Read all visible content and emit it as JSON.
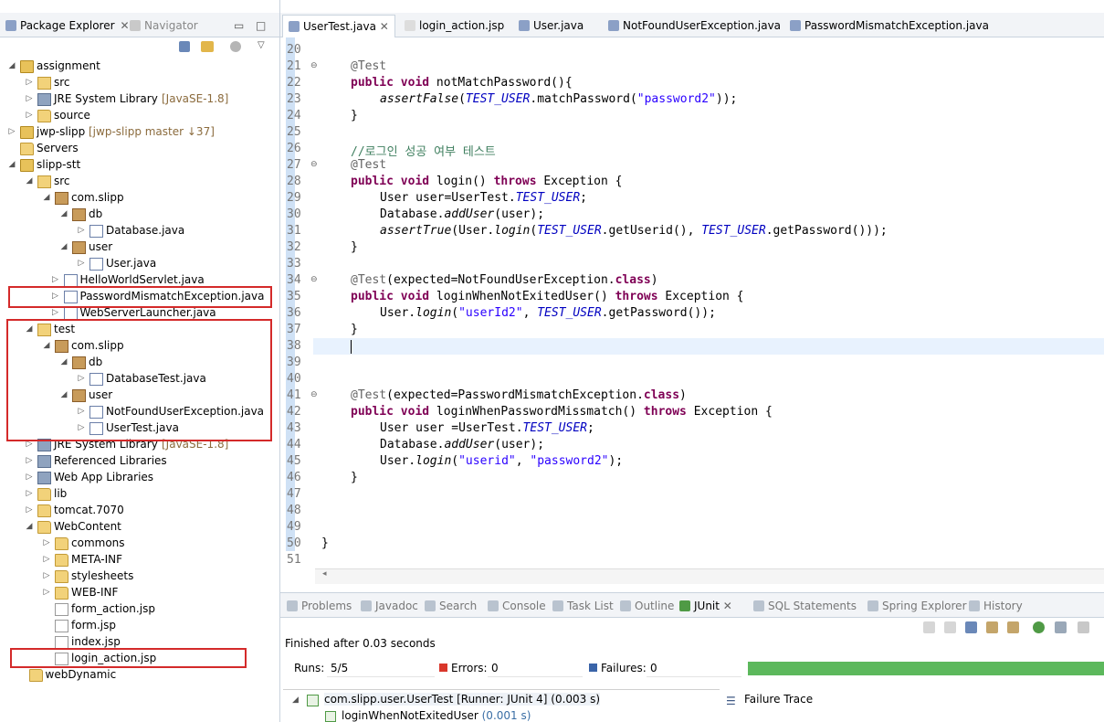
{
  "explorer": {
    "tab_active": "Package Explorer",
    "tab_inactive": "Navigator",
    "tree": [
      {
        "label": "assignment",
        "deco": "",
        "indent": 0,
        "twisty": "open",
        "icon": "proj"
      },
      {
        "label": "src",
        "deco": "",
        "indent": 1,
        "twisty": "closed",
        "icon": "srcfolder"
      },
      {
        "label": "JRE System Library",
        "deco": "[JavaSE-1.8]",
        "indent": 1,
        "twisty": "closed",
        "icon": "lib"
      },
      {
        "label": "source",
        "deco": "",
        "indent": 1,
        "twisty": "closed",
        "icon": "folder"
      },
      {
        "label": "jwp-slipp",
        "deco": "[jwp-slipp master ↓37]",
        "indent": 0,
        "twisty": "closed",
        "icon": "proj"
      },
      {
        "label": "Servers",
        "deco": "",
        "indent": 0,
        "twisty": "none",
        "icon": "folder"
      },
      {
        "label": "slipp-stt",
        "deco": "",
        "indent": 0,
        "twisty": "open",
        "icon": "proj"
      },
      {
        "label": "src",
        "deco": "",
        "indent": 1,
        "twisty": "open",
        "icon": "srcfolder"
      },
      {
        "label": "com.slipp",
        "deco": "",
        "indent": 2,
        "twisty": "open",
        "icon": "pkg"
      },
      {
        "label": "db",
        "deco": "",
        "indent": 3,
        "twisty": "open",
        "icon": "pkg"
      },
      {
        "label": "Database.java",
        "deco": "",
        "indent": 4,
        "twisty": "closed",
        "icon": "java"
      },
      {
        "label": "user",
        "deco": "",
        "indent": 3,
        "twisty": "open",
        "icon": "pkg"
      },
      {
        "label": "User.java",
        "deco": "",
        "indent": 4,
        "twisty": "closed",
        "icon": "java"
      },
      {
        "label": "HelloWorldServlet.java",
        "deco": "",
        "indent": 2.5,
        "twisty": "closed",
        "icon": "java"
      },
      {
        "label": "PasswordMismatchException.java",
        "deco": "",
        "indent": 2.5,
        "twisty": "closed",
        "icon": "java"
      },
      {
        "label": "WebServerLauncher.java",
        "deco": "",
        "indent": 2.5,
        "twisty": "closed",
        "icon": "java"
      },
      {
        "label": "test",
        "deco": "",
        "indent": 1,
        "twisty": "open",
        "icon": "srcfolder"
      },
      {
        "label": "com.slipp",
        "deco": "",
        "indent": 2,
        "twisty": "open",
        "icon": "pkg"
      },
      {
        "label": "db",
        "deco": "",
        "indent": 3,
        "twisty": "open",
        "icon": "pkg"
      },
      {
        "label": "DatabaseTest.java",
        "deco": "",
        "indent": 4,
        "twisty": "closed",
        "icon": "java"
      },
      {
        "label": "user",
        "deco": "",
        "indent": 3,
        "twisty": "open",
        "icon": "pkg"
      },
      {
        "label": "NotFoundUserException.java",
        "deco": "",
        "indent": 4,
        "twisty": "closed",
        "icon": "java"
      },
      {
        "label": "UserTest.java",
        "deco": "",
        "indent": 4,
        "twisty": "closed",
        "icon": "java"
      },
      {
        "label": "JRE System Library",
        "deco": "[JavaSE-1.8]",
        "indent": 1,
        "twisty": "closed",
        "icon": "lib"
      },
      {
        "label": "Referenced Libraries",
        "deco": "",
        "indent": 1,
        "twisty": "closed",
        "icon": "lib"
      },
      {
        "label": "Web App Libraries",
        "deco": "",
        "indent": 1,
        "twisty": "closed",
        "icon": "lib"
      },
      {
        "label": "lib",
        "deco": "",
        "indent": 1,
        "twisty": "closed",
        "icon": "folder"
      },
      {
        "label": "tomcat.7070",
        "deco": "",
        "indent": 1,
        "twisty": "closed",
        "icon": "folder"
      },
      {
        "label": "WebContent",
        "deco": "",
        "indent": 1,
        "twisty": "open",
        "icon": "folder"
      },
      {
        "label": "commons",
        "deco": "",
        "indent": 2,
        "twisty": "closed",
        "icon": "folder"
      },
      {
        "label": "META-INF",
        "deco": "",
        "indent": 2,
        "twisty": "closed",
        "icon": "folder"
      },
      {
        "label": "stylesheets",
        "deco": "",
        "indent": 2,
        "twisty": "closed",
        "icon": "folder"
      },
      {
        "label": "WEB-INF",
        "deco": "",
        "indent": 2,
        "twisty": "closed",
        "icon": "folder"
      },
      {
        "label": "form_action.jsp",
        "deco": "",
        "indent": 2,
        "twisty": "none",
        "icon": "jsp"
      },
      {
        "label": "form.jsp",
        "deco": "",
        "indent": 2,
        "twisty": "none",
        "icon": "jsp"
      },
      {
        "label": "index.jsp",
        "deco": "",
        "indent": 2,
        "twisty": "none",
        "icon": "jsp"
      },
      {
        "label": "login_action.jsp",
        "deco": "",
        "indent": 2,
        "twisty": "none",
        "icon": "jsp"
      },
      {
        "label": "webDynamic",
        "deco": "",
        "indent": 0.5,
        "twisty": "none",
        "icon": "folder"
      }
    ]
  },
  "editor": {
    "tabs": [
      "UserTest.java",
      "login_action.jsp",
      "User.java",
      "NotFoundUserException.java",
      "PasswordMismatchException.java"
    ],
    "active_tab": "UserTest.java"
  },
  "code": {
    "line_numbers": [
      "20",
      "21",
      "22",
      "23",
      "24",
      "25",
      "26",
      "27",
      "28",
      "29",
      "30",
      "31",
      "32",
      "33",
      "34",
      "35",
      "36",
      "37",
      "38",
      "39",
      "40",
      "41",
      "42",
      "43",
      "44",
      "45",
      "46",
      "47",
      "48",
      "49",
      "50",
      "51"
    ],
    "l21_a": "@Test",
    "l22_kw1": "public",
    "l22_kw2": "void",
    "l22_rest": " notMatchPassword(){",
    "l23_call": "assertFalse",
    "l23_const": "TEST_USER",
    "l23_mid": ".matchPassword(",
    "l23_str": "\"password2\"",
    "l23_end": "));",
    "brace_close": "}",
    "l26_comment": "//로그인 성공 여부 테스트",
    "l27_a": "@Test",
    "l28_kw1": "public",
    "l28_kw2": "void",
    "l28_mid": " login() ",
    "l28_kw3": "throws",
    "l28_end": " Exception {",
    "l29_a": "User user=UserTest.",
    "l29_const": "TEST_USER",
    "l29_end": ";",
    "l30_a": "Database.",
    "l30_call": "addUser",
    "l30_end": "(user);",
    "l31_call": "assertTrue",
    "l31_a": "(User.",
    "l31_call2": "login",
    "l31_b": "(",
    "l31_const": "TEST_USER",
    "l31_c": ".getUserid(), ",
    "l31_const2": "TEST_USER",
    "l31_end": ".getPassword()));",
    "l34_a": "@Test",
    "l34_b": "(expected=NotFoundUserException.",
    "l34_kw": "class",
    "l34_end": ")",
    "l35_kw1": "public",
    "l35_kw2": "void",
    "l35_mid": " loginWhenNotExitedUser() ",
    "l35_kw3": "throws",
    "l35_end": " Exception {",
    "l36_a": "User.",
    "l36_call": "login",
    "l36_b": "(",
    "l36_str": "\"userId2\"",
    "l36_c": ", ",
    "l36_const": "TEST_USER",
    "l36_end": ".getPassword());",
    "l41_a": "@Test",
    "l41_b": "(expected=PasswordMismatchException.",
    "l41_kw": "class",
    "l41_end": ")",
    "l42_kw1": "public",
    "l42_kw2": "void",
    "l42_mid": " loginWhenPasswordMissmatch() ",
    "l42_kw3": "throws",
    "l42_end": " Exception {",
    "l43_a": "User user =UserTest.",
    "l43_const": "TEST_USER",
    "l43_end": ";",
    "l44_a": "Database.",
    "l44_call": "addUser",
    "l44_end": "(user);",
    "l45_a": "User.",
    "l45_call": "login",
    "l45_b": "(",
    "l45_str": "\"userid\"",
    "l45_c": ", ",
    "l45_str2": "\"password2\"",
    "l45_end": ");"
  },
  "bottom": {
    "tabs": [
      "Problems",
      "Javadoc",
      "Search",
      "Console",
      "Task List",
      "Outline",
      "JUnit",
      "SQL Statements",
      "Spring Explorer",
      "History"
    ],
    "active_tab": "JUnit",
    "status": "Finished after 0.03 seconds",
    "runs_label": "Runs:",
    "runs_value": "5/5",
    "errors_label": "Errors:",
    "errors_value": "0",
    "failures_label": "Failures:",
    "failures_value": "0",
    "progress_fraction": 1.0,
    "test_root": "com.slipp.user.UserTest [Runner: JUnit 4] (0.003 s)",
    "test_child": "loginWhenNotExitedUser",
    "test_child_time": "(0.001 s)",
    "failure_trace_label": "Failure Trace"
  },
  "colors": {
    "accent": "#5cb85c",
    "highlight_box": "#d42a2a",
    "keyword": "#7f0055",
    "string": "#2a00ff",
    "constant": "#0000c0",
    "comment": "#3f7f5f"
  }
}
